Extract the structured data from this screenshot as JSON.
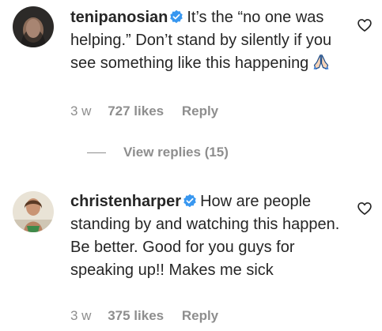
{
  "comments": [
    {
      "username": "tenipanosian",
      "text": "It’s the “no one was helping.” Don’t stand by silently if you see something like this happening",
      "emoji": "folded-hands",
      "time": "3 w",
      "likes": "727 likes",
      "reply_label": "Reply"
    },
    {
      "username": "christenharper",
      "text": "How are people standing by and watching this happen. Be better. Good for you guys for speaking up!! Makes me sick",
      "time": "3 w",
      "likes": "375 likes",
      "reply_label": "Reply"
    }
  ],
  "view_replies_label": "View replies (15)",
  "icons": {
    "verified": "verified-badge-icon",
    "like": "heart-outline-icon",
    "emoji": "folded-hands-emoji-icon"
  },
  "colors": {
    "text": "#262626",
    "muted": "#8e8e8e",
    "verified": "#3897f0"
  }
}
